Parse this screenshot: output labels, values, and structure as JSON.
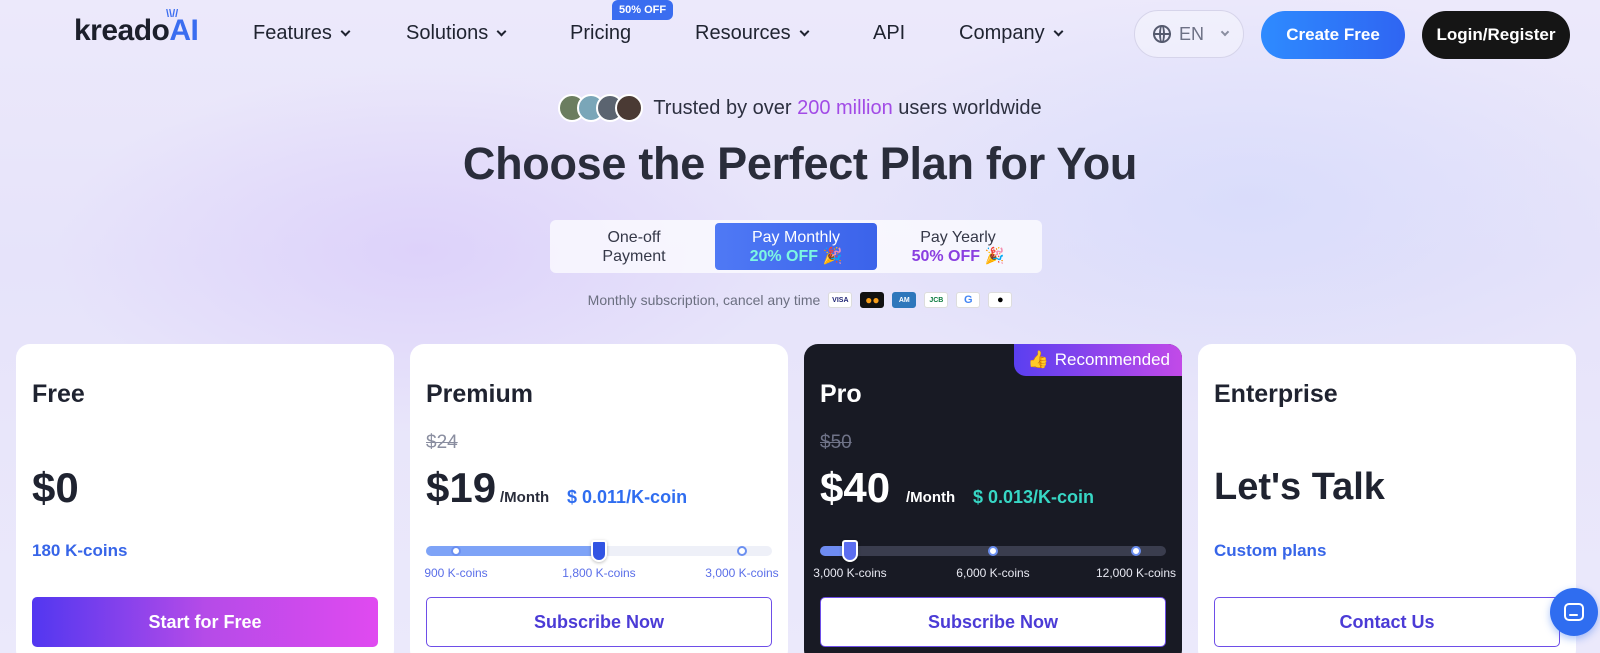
{
  "nav": {
    "logo_text": "kreado",
    "logo_ai": "AI",
    "items": [
      {
        "label": "Features",
        "has_dropdown": true
      },
      {
        "label": "Solutions",
        "has_dropdown": true
      },
      {
        "label": "Pricing",
        "has_dropdown": false,
        "badge": "50% OFF"
      },
      {
        "label": "Resources",
        "has_dropdown": true
      },
      {
        "label": "API",
        "has_dropdown": false
      },
      {
        "label": "Company",
        "has_dropdown": true
      }
    ],
    "language": "EN",
    "create_label": "Create Free",
    "login_label": "Login/Register"
  },
  "hero": {
    "trusted_prefix": "Trusted by over",
    "trusted_highlight": "200 million",
    "trusted_suffix": "users worldwide",
    "headline": "Choose the Perfect Plan for You"
  },
  "billing": {
    "options": [
      {
        "line1": "One-off",
        "line2": "Payment",
        "active": false
      },
      {
        "line1": "Pay Monthly",
        "line2": "20% OFF",
        "active": true
      },
      {
        "line1": "Pay Yearly",
        "line2": "50% OFF",
        "active": false
      }
    ],
    "note": "Monthly subscription, cancel any time",
    "payment_icons": [
      "visa-icon",
      "mastercard-icon",
      "amex-icon",
      "jcb-icon",
      "google-pay-icon",
      "apple-pay-icon"
    ]
  },
  "plans": {
    "free": {
      "name": "Free",
      "price": "$0",
      "coins": "180 K-coins",
      "cta": "Start for Free"
    },
    "premium": {
      "name": "Premium",
      "old_price": "$24",
      "price": "$19",
      "unit": "/Month",
      "rate": "$ 0.011/K-coin",
      "ticks": [
        "900 K-coins",
        "1,800 K-coins",
        "3,000 K-coins"
      ],
      "selected_index": 1,
      "cta": "Subscribe Now"
    },
    "pro": {
      "name": "Pro",
      "badge": "Recommended",
      "old_price": "$50",
      "price": "$40",
      "unit": "/Month",
      "rate": "$ 0.013/K-coin",
      "ticks": [
        "3,000 K-coins",
        "6,000 K-coins",
        "12,000 K-coins"
      ],
      "selected_index": 0,
      "cta": "Subscribe Now"
    },
    "enterprise": {
      "name": "Enterprise",
      "price": "Let's Talk",
      "coins": "Custom plans",
      "cta": "Contact Us"
    }
  },
  "colors": {
    "accent_blue": "#2f6df0",
    "accent_purple": "#a24be6",
    "dark_card": "#181a24"
  }
}
